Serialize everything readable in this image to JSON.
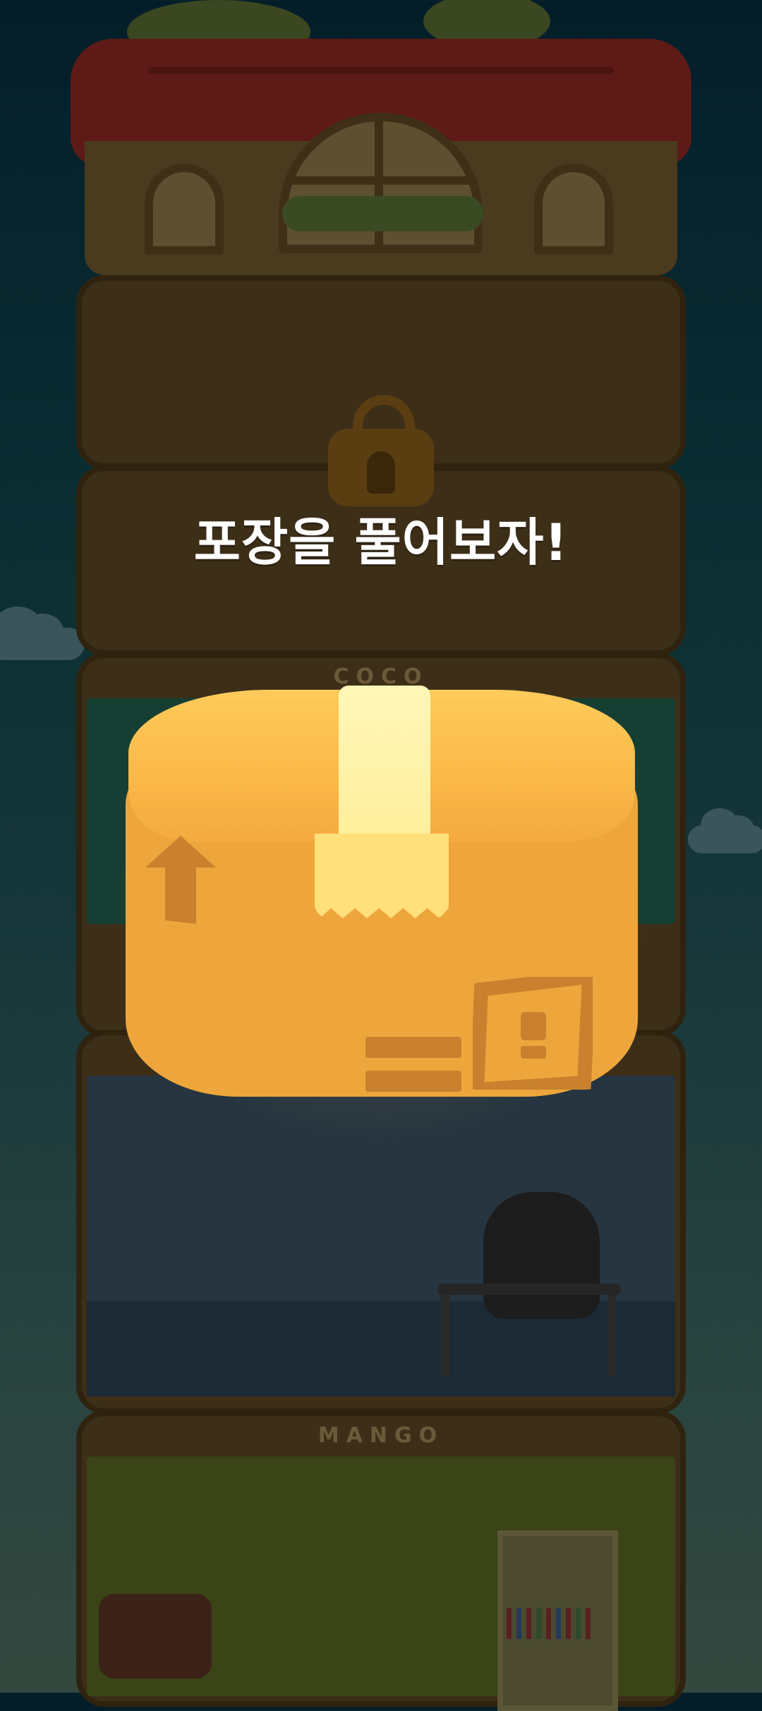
{
  "screen": {
    "headline": "포장을 풀어보자!"
  },
  "building": {
    "floor_signs": [
      "COCO",
      "MANGO"
    ]
  },
  "package": {
    "state": "wrapped",
    "icons": [
      "up-arrow-icon",
      "fragile-label-icon",
      "shipping-bars-icon"
    ]
  },
  "colors": {
    "box": "#eea63c",
    "box_top": "#fab848",
    "tape": "#fff3a8",
    "headline": "#ffffff"
  }
}
